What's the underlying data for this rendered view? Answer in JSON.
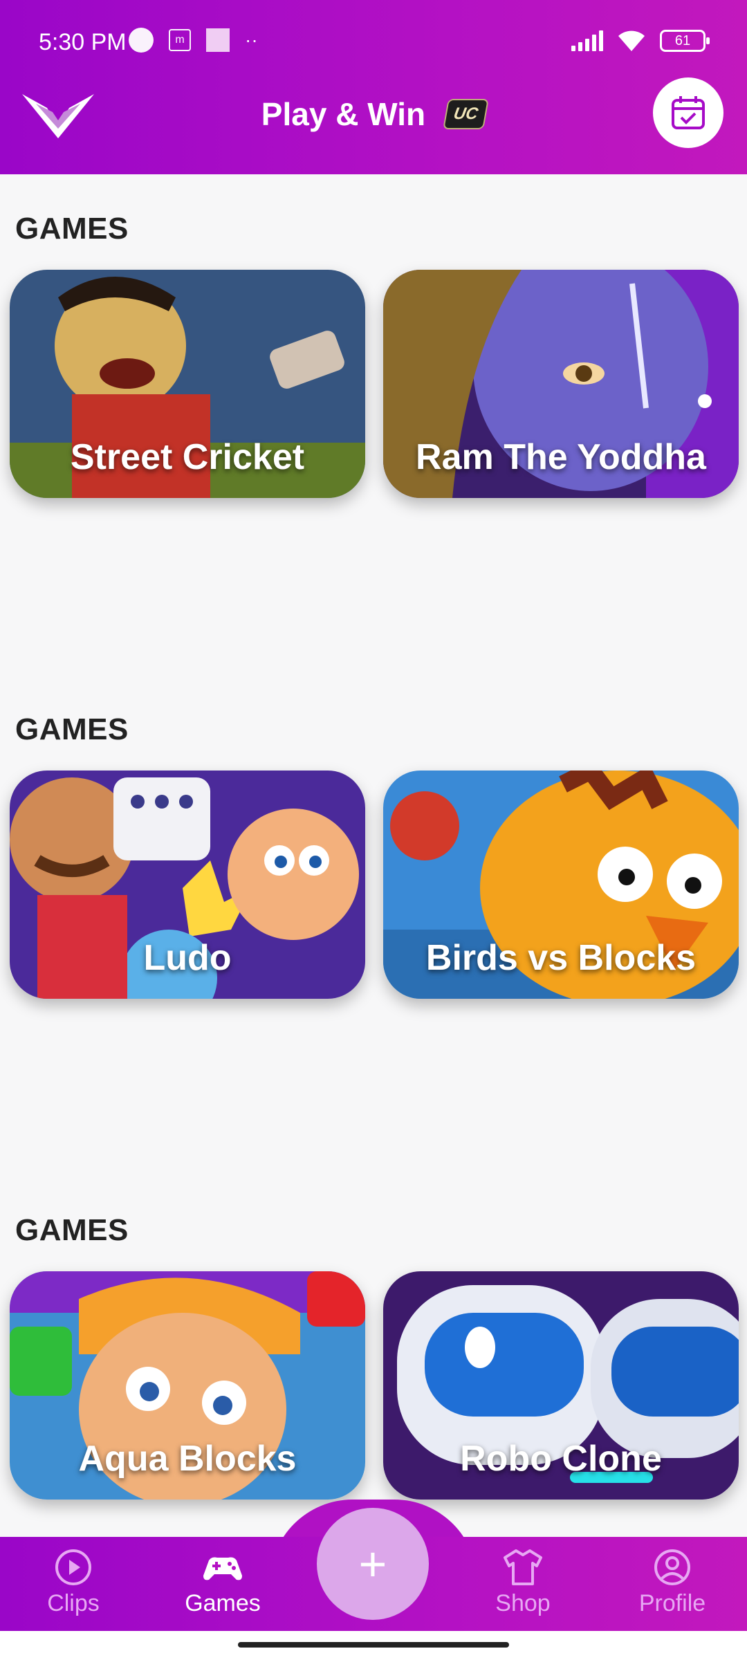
{
  "status_bar": {
    "time": "5:30 PM",
    "battery": "61"
  },
  "header": {
    "title": "Play & Win",
    "badge": "UC"
  },
  "sections": [
    {
      "title": "GAMES",
      "games": [
        {
          "name": "Street Cricket"
        },
        {
          "name": "Ram The Yoddha"
        }
      ]
    },
    {
      "title": "GAMES",
      "games": [
        {
          "name": "Ludo"
        },
        {
          "name": "Birds vs Blocks"
        }
      ]
    },
    {
      "title": "GAMES",
      "games": [
        {
          "name": "Aqua Blocks"
        },
        {
          "name": "Robo Clone"
        }
      ]
    }
  ],
  "bottom_nav": {
    "items": [
      {
        "label": "Clips",
        "icon": "play-circle-icon"
      },
      {
        "label": "Games",
        "icon": "gamepad-icon"
      },
      {
        "label": "Shop",
        "icon": "tshirt-icon"
      },
      {
        "label": "Profile",
        "icon": "user-circle-icon"
      }
    ],
    "fab_symbol": "+"
  },
  "colors": {
    "brand_purple": "#a60bc7",
    "nav_inactive": "#e7a8f3",
    "fab": "#dca7ea"
  }
}
